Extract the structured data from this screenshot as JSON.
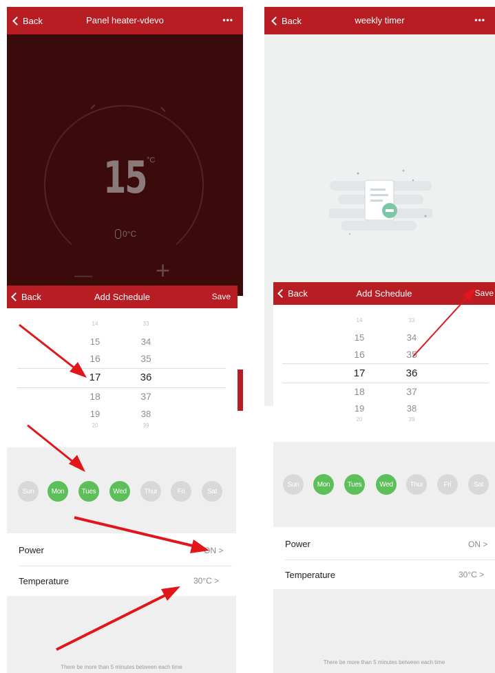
{
  "left": {
    "heater": {
      "back_label": "Back",
      "title": "Panel heater-vdevo",
      "more": "•••",
      "set_temp": "15",
      "set_unit": "°C",
      "room_temp": "0°C",
      "minus": "—",
      "plus": "+"
    },
    "schedule": {
      "back_label": "Back",
      "title": "Add Schedule",
      "save_label": "Save",
      "hours": [
        "14",
        "15",
        "16",
        "17",
        "18",
        "19",
        "20"
      ],
      "minutes": [
        "33",
        "34",
        "35",
        "36",
        "37",
        "38",
        "39"
      ],
      "selected_hour": "17",
      "selected_minute": "36",
      "days": [
        {
          "label": "Sun",
          "selected": false
        },
        {
          "label": "Mon",
          "selected": true
        },
        {
          "label": "Tues",
          "selected": true
        },
        {
          "label": "Wed",
          "selected": true
        },
        {
          "label": "Thur",
          "selected": false
        },
        {
          "label": "Fri",
          "selected": false
        },
        {
          "label": "Sat",
          "selected": false
        }
      ],
      "power_label": "Power",
      "power_value": "ON >",
      "temperature_label": "Temperature",
      "temperature_value": "30°C >",
      "footnote": "There be more than 5 minutes between each time"
    }
  },
  "right": {
    "timer": {
      "back_label": "Back",
      "title": "weekly timer",
      "more": "•••"
    },
    "schedule": {
      "back_label": "Back",
      "title": "Add Schedule",
      "save_label": "Save",
      "hours": [
        "14",
        "15",
        "16",
        "17",
        "18",
        "19",
        "20"
      ],
      "minutes": [
        "33",
        "34",
        "35",
        "36",
        "37",
        "38",
        "39"
      ],
      "days": [
        {
          "label": "Sun",
          "selected": false
        },
        {
          "label": "Mon",
          "selected": true
        },
        {
          "label": "Tues",
          "selected": true
        },
        {
          "label": "Wed",
          "selected": true
        },
        {
          "label": "Thur",
          "selected": false
        },
        {
          "label": "Fri",
          "selected": false
        },
        {
          "label": "Sat",
          "selected": false
        }
      ],
      "power_label": "Power",
      "power_value": "ON >",
      "temperature_label": "Temperature",
      "temperature_value": "30°C >",
      "footnote": "There be more than 5 minutes between each time"
    }
  },
  "colors": {
    "header_red": "#b81d24",
    "heater_bg": "#3b0b0b",
    "day_on": "#5cbf5a",
    "day_off": "#d8d8d8",
    "arrow_red": "#e0161b"
  }
}
